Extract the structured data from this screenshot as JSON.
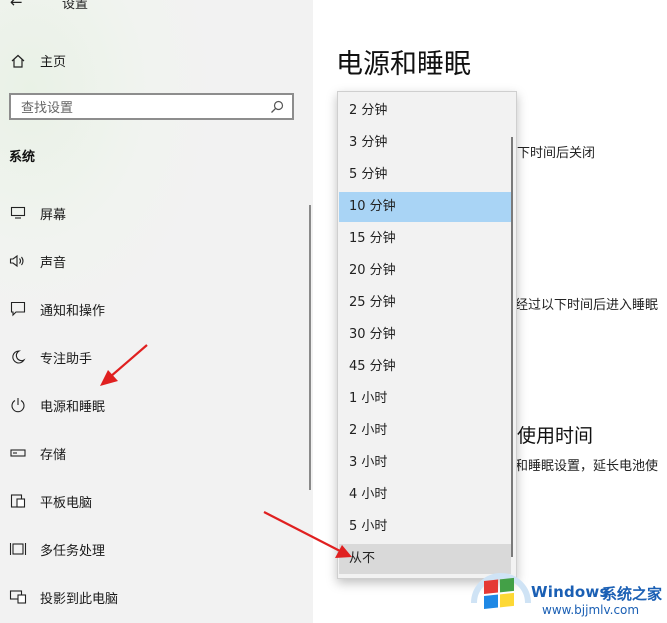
{
  "app": {
    "back_icon": "arrow-left-icon",
    "title": "设置"
  },
  "sidebar": {
    "home_label": "主页",
    "search_placeholder": "查找设置",
    "section_title": "系统",
    "items": [
      {
        "label": "屏幕",
        "icon": "monitor-icon"
      },
      {
        "label": "声音",
        "icon": "speaker-icon"
      },
      {
        "label": "通知和操作",
        "icon": "notification-icon"
      },
      {
        "label": "专注助手",
        "icon": "moon-icon"
      },
      {
        "label": "电源和睡眠",
        "icon": "power-icon"
      },
      {
        "label": "存储",
        "icon": "storage-icon"
      },
      {
        "label": "平板电脑",
        "icon": "tablet-icon"
      },
      {
        "label": "多任务处理",
        "icon": "multitask-icon"
      },
      {
        "label": "投影到此电脑",
        "icon": "project-icon"
      }
    ]
  },
  "main": {
    "page_title": "电源和睡眠",
    "text_fragment_1": "下时间后关闭",
    "text_fragment_2": "经过以下时间后进入睡眠",
    "heading_fragment": "使用时间",
    "text_fragment_3": "和睡眠设置，延长电池使"
  },
  "dropdown": {
    "options": [
      "2 分钟",
      "3 分钟",
      "5 分钟",
      "10 分钟",
      "15 分钟",
      "20 分钟",
      "25 分钟",
      "30 分钟",
      "45 分钟",
      "1 小时",
      "2 小时",
      "3 小时",
      "4 小时",
      "5 小时",
      "从不"
    ],
    "selected": "10 分钟",
    "hovered": "从不"
  },
  "watermark": {
    "brand": "Windows",
    "cn_text": "系统之家",
    "url": "www.bjjmlv.com"
  },
  "colors": {
    "selected_bg": "#a9d4f5",
    "arrow": "#e02020",
    "watermark": "#1a5fb4"
  }
}
